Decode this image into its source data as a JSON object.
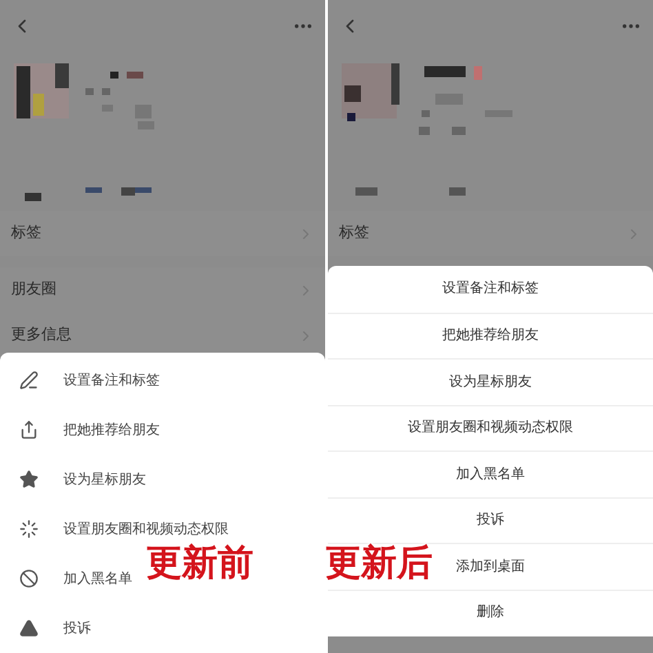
{
  "panels": [
    {
      "caption": "更新前",
      "profile_rows": [
        {
          "label": "标签"
        },
        {
          "label": "朋友圈"
        },
        {
          "label": "更多信息"
        }
      ],
      "sheet": {
        "kind": "icon-list",
        "items": [
          {
            "label": "设置备注和标签"
          },
          {
            "label": "把她推荐给朋友"
          },
          {
            "label": "设为星标朋友"
          },
          {
            "label": "设置朋友圈和视频动态权限"
          },
          {
            "label": "加入黑名单"
          },
          {
            "label": "投诉"
          }
        ]
      }
    },
    {
      "caption": "更新后",
      "profile_rows": [
        {
          "label": "标签"
        }
      ],
      "sheet": {
        "kind": "centered",
        "items": [
          {
            "label": "设置备注和标签"
          },
          {
            "label": "把她推荐给朋友"
          },
          {
            "label": "设为星标朋友"
          },
          {
            "label": "设置朋友圈和视频动态权限"
          },
          {
            "label": "加入黑名单"
          },
          {
            "label": "投诉"
          },
          {
            "label": "添加到桌面"
          },
          {
            "label": "删除"
          }
        ]
      }
    }
  ]
}
